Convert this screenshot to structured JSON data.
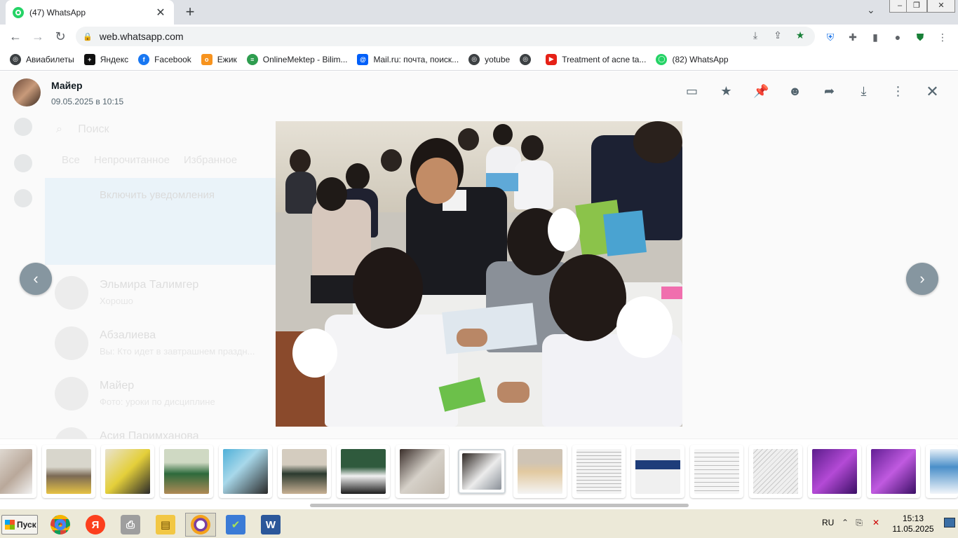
{
  "browser": {
    "tab_title": "(47) WhatsApp",
    "url": "web.whatsapp.com"
  },
  "bookmarks": [
    {
      "label": "Авиабилеты",
      "color": "#3c4043"
    },
    {
      "label": "Яндекс",
      "color": "#111111"
    },
    {
      "label": "Facebook",
      "color": "#1877f2"
    },
    {
      "label": "Ежик",
      "color": "#f7931e"
    },
    {
      "label": "OnlineMektep - Bilim...",
      "color": "#2e9d4f"
    },
    {
      "label": "Mail.ru: почта, поиск...",
      "color": "#005ff9"
    },
    {
      "label": "yotube",
      "color": "#3c4043"
    },
    {
      "label": "",
      "color": "#3c4043"
    },
    {
      "label": "Treatment of acne ta...",
      "color": "#e62117"
    },
    {
      "label": "(82) WhatsApp",
      "color": "#25d366"
    }
  ],
  "viewer": {
    "sender_name": "Майер",
    "sent_date": "09.05.2025 в 10:15",
    "active_thumb_index": 8
  },
  "background_chats": {
    "search_placeholder": "Поиск",
    "filters": [
      "Все",
      "Непрочитанное",
      "Избранное"
    ],
    "notice": "Включить уведомления",
    "chats": [
      {
        "name": "Эльмира Талимгер",
        "preview": "Хорошо"
      },
      {
        "name": "Абзалиева",
        "preview": "Вы: Кто идет в завтрашнем праздн..."
      },
      {
        "name": "Майер",
        "preview": "Фото: уроки по дисциплине"
      },
      {
        "name": "Асия Паримханова",
        "preview": ""
      }
    ]
  },
  "taskbar": {
    "start_label": "Пуск",
    "language": "RU",
    "time": "15:13",
    "date": "11.05.2025"
  }
}
